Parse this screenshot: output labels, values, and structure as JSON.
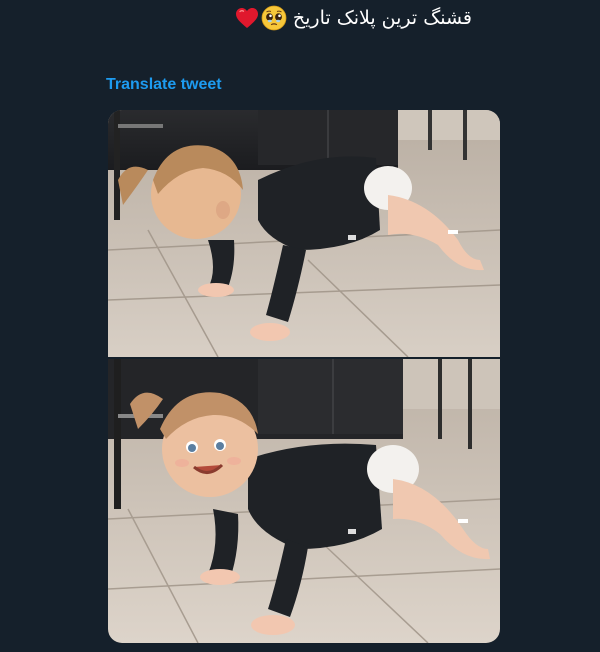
{
  "tweet": {
    "text": "قشنگ ترین پلانک تاریخ",
    "emojis": [
      "pleading-face-emoji",
      "red-heart-emoji"
    ],
    "translate_label": "Translate tweet"
  },
  "media": {
    "images": [
      {
        "name": "baby-plank-photo-top"
      },
      {
        "name": "baby-plank-photo-bottom"
      }
    ]
  },
  "colors": {
    "background": "#15202b",
    "link": "#1d9bf0",
    "text": "#ffffff"
  }
}
